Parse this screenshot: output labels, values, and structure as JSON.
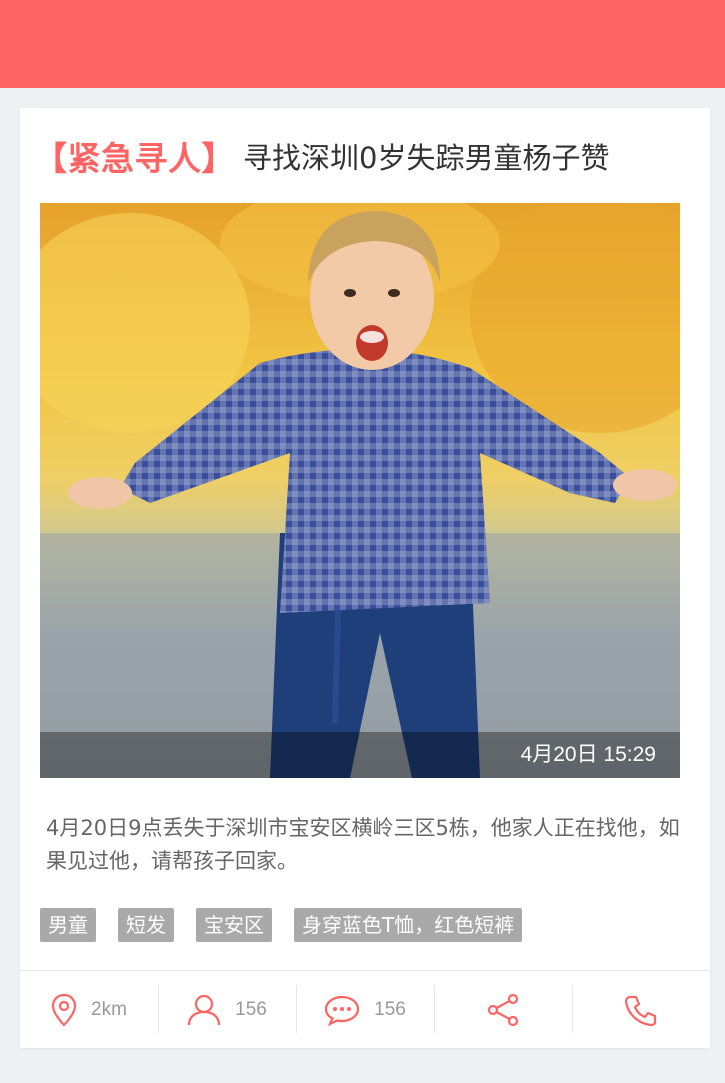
{
  "header": {
    "color": "#ff6464"
  },
  "post": {
    "tag": "【紧急寻人】",
    "title": "寻找深圳0岁失踪男童杨子赞",
    "photo": {
      "alt": "",
      "timestamp": "4月20日  15:29"
    },
    "description": "4月20日9点丢失于深圳市宝安区横岭三区5栋，他家人正在找他，如果见过他，请帮孩子回家。",
    "tags": [
      "男童",
      "短发",
      "宝安区",
      "身穿蓝色T恤，红色短裤"
    ]
  },
  "actions": {
    "distance": {
      "icon": "location-pin-icon",
      "label": "2km"
    },
    "followers": {
      "icon": "person-icon",
      "label": "156"
    },
    "comments": {
      "icon": "chat-bubble-icon",
      "label": "156"
    },
    "share": {
      "icon": "share-icon"
    },
    "call": {
      "icon": "phone-icon"
    }
  },
  "colors": {
    "accent": "#ff6464",
    "tag_bg": "#a9a9a9",
    "text": "#333333",
    "muted": "#999999"
  }
}
